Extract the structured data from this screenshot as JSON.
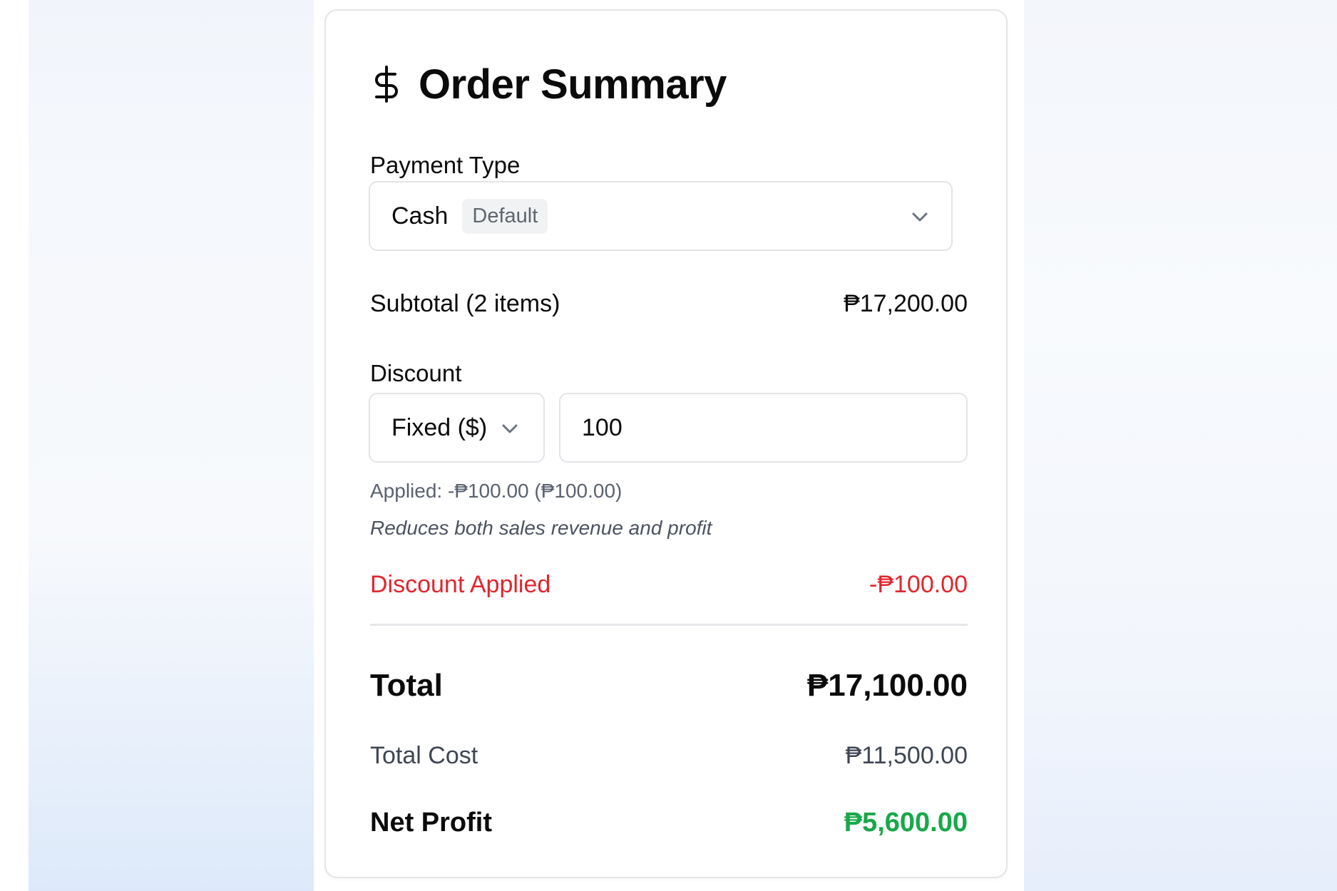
{
  "order_summary": {
    "title": "Order Summary",
    "icon": "dollar-sign-icon",
    "payment": {
      "label": "Payment Type",
      "selected": "Cash",
      "badge": "Default"
    },
    "subtotal": {
      "label": "Subtotal (2 items)",
      "value": "₱17,200.00"
    },
    "discount": {
      "label": "Discount",
      "type_selected": "Fixed ($)",
      "amount_value": "100",
      "applied_note": "Applied: -₱100.00 (₱100.00)",
      "reduces_note": "Reduces both sales revenue and profit"
    },
    "discount_applied": {
      "label": "Discount Applied",
      "value": "-₱100.00"
    },
    "total": {
      "label": "Total",
      "value": "₱17,100.00"
    },
    "total_cost": {
      "label": "Total Cost",
      "value": "₱11,500.00"
    },
    "net_profit": {
      "label": "Net Profit",
      "value": "₱5,600.00"
    }
  },
  "colors": {
    "discount_red": "#e0262d",
    "profit_green": "#18a84a",
    "muted_text": "#5a6270",
    "border": "#e2e4e8"
  }
}
